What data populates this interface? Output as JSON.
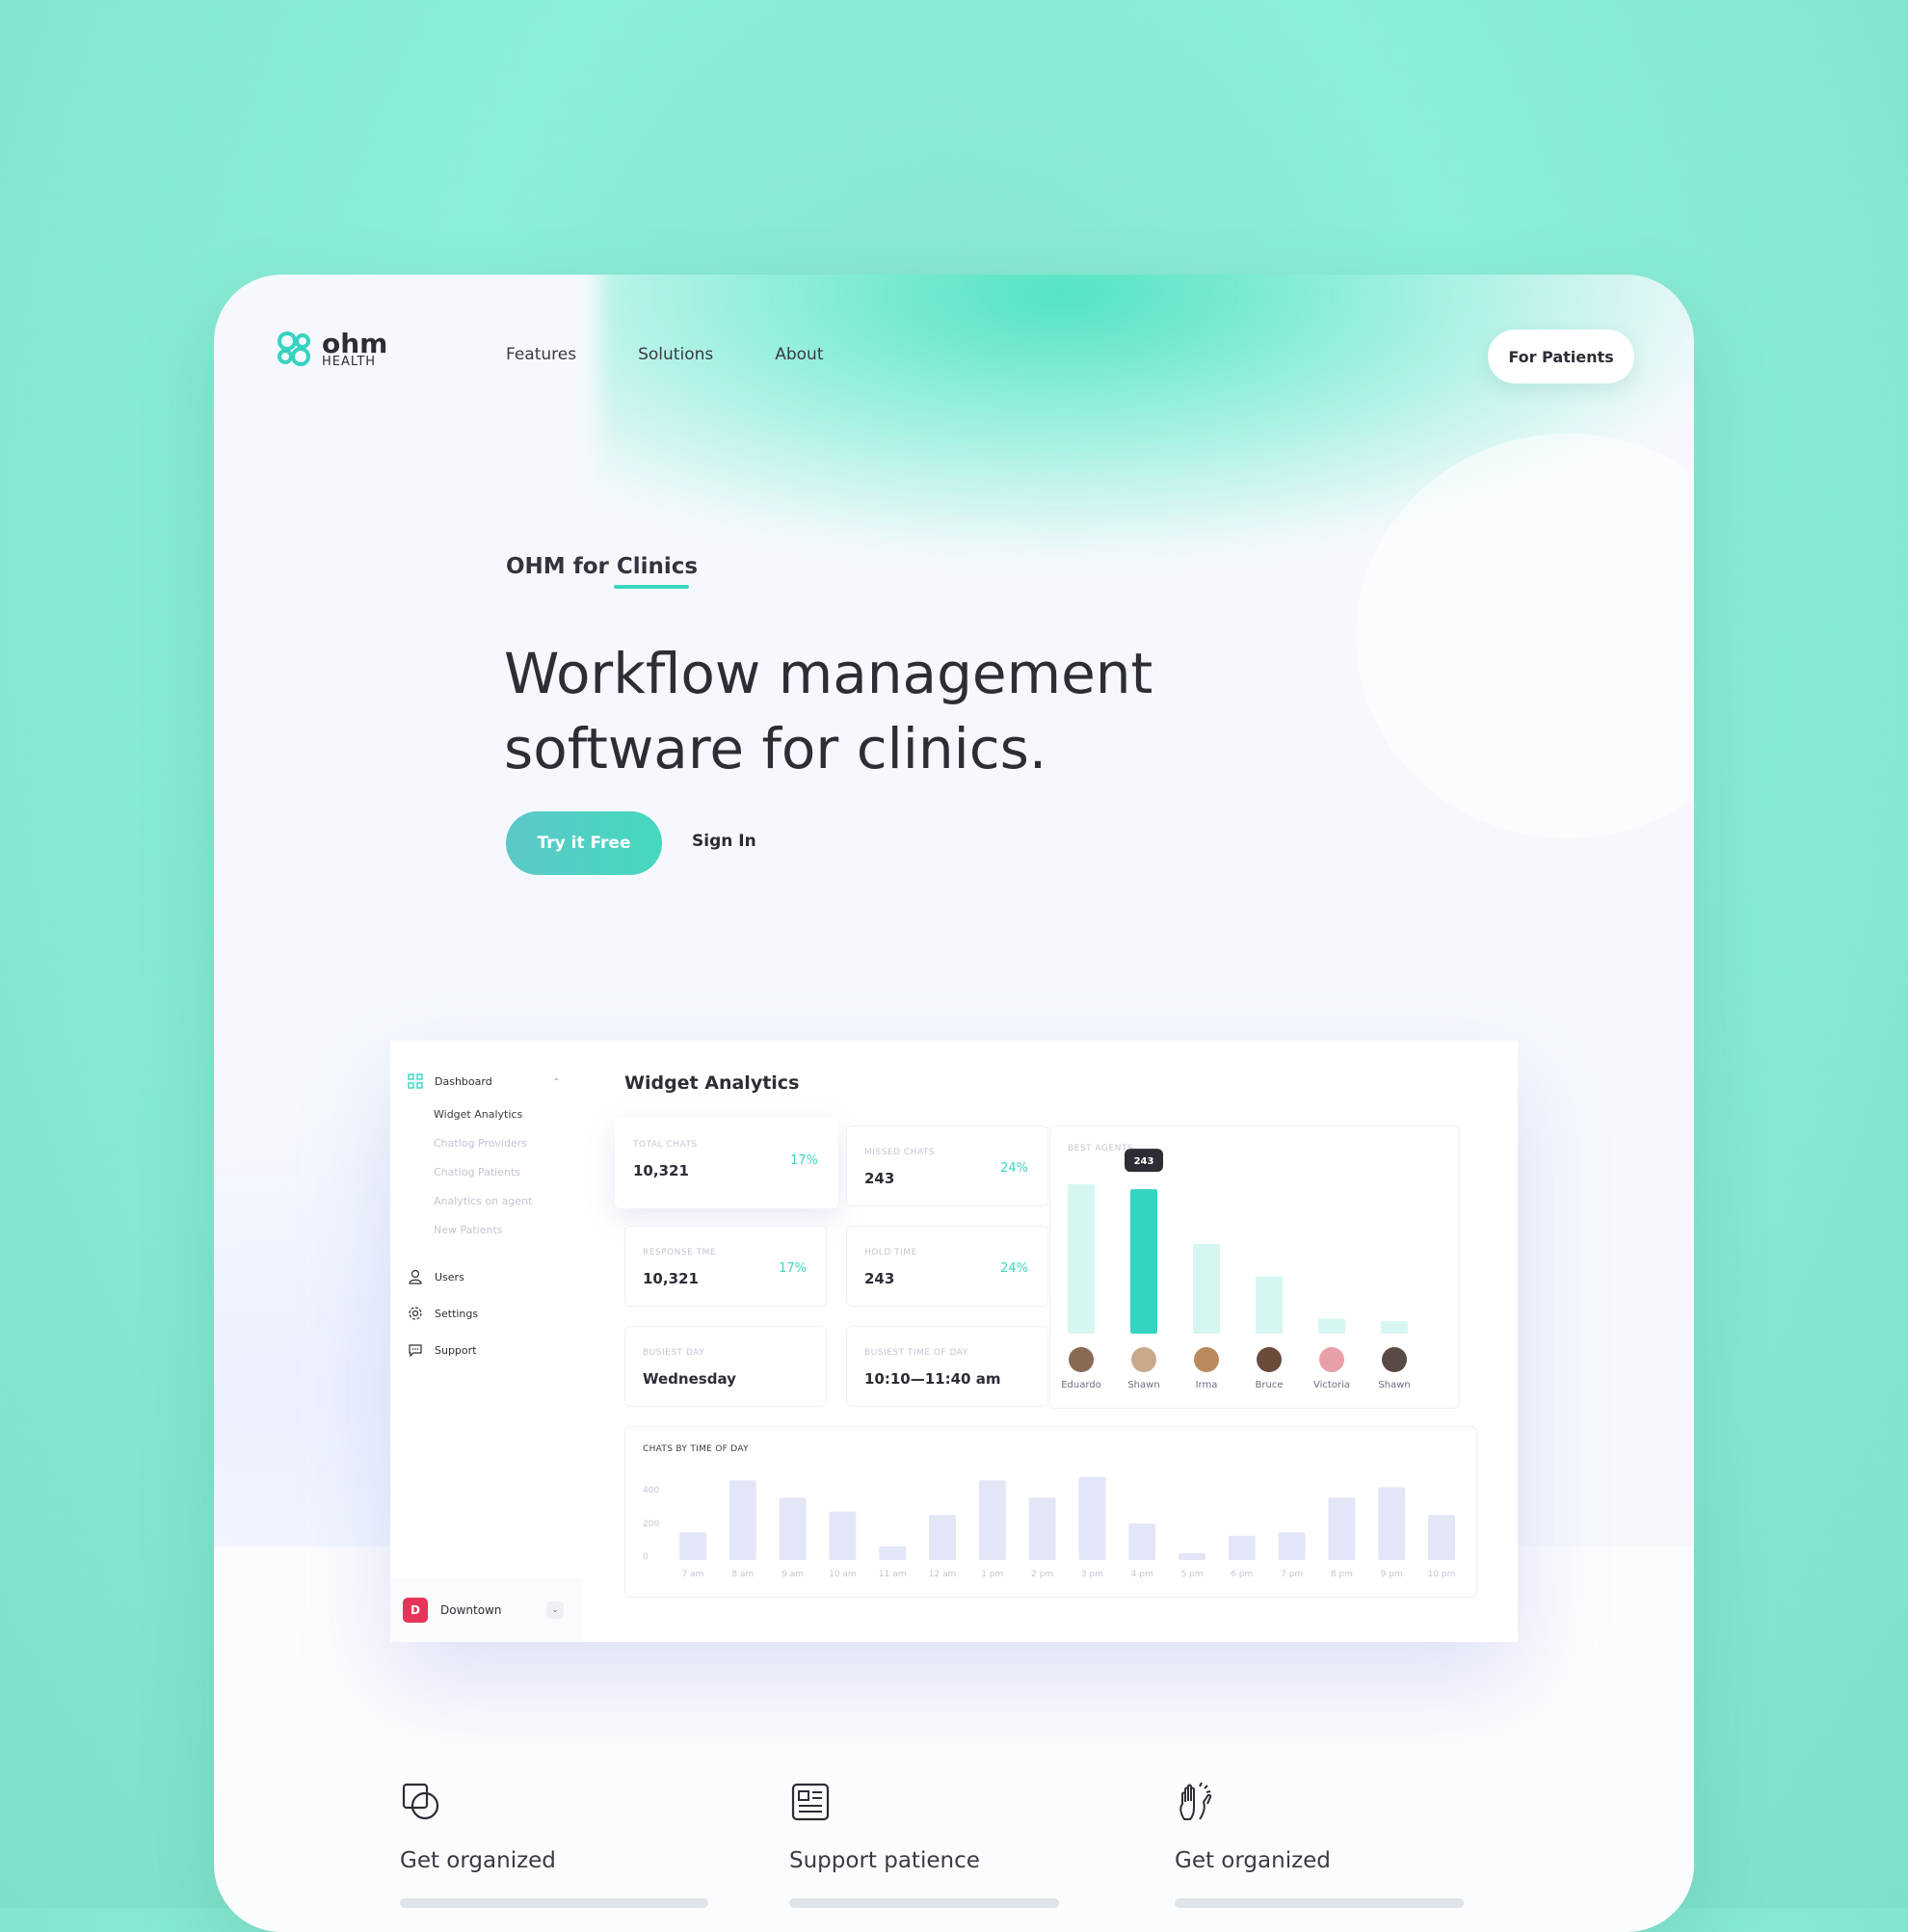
{
  "brand": {
    "name": "ohm",
    "sub": "HEALTH"
  },
  "nav": {
    "items": [
      "Features",
      "Solutions",
      "About"
    ],
    "cta": "For Patients"
  },
  "hero": {
    "eyebrow": "OHM for Clinics",
    "headline_line1": "Workflow management",
    "headline_line2": "software for clinics.",
    "primary_cta": "Try it Free",
    "secondary_cta": "Sign In"
  },
  "dashboard": {
    "title": "Widget Analytics",
    "sidebar": {
      "dashboard_label": "Dashboard",
      "subitems": [
        "Widget Analytics",
        "Chatlog Providers",
        "Chatlog Patients",
        "Analytics on agent",
        "New Patients"
      ],
      "items": [
        "Users",
        "Settings",
        "Support"
      ]
    },
    "location": {
      "initial": "D",
      "label": "Downtown"
    },
    "stats": [
      {
        "label": "TOTAL CHATS",
        "value": "10,321",
        "pct": "17%"
      },
      {
        "label": "MISSED CHATS",
        "value": "243",
        "pct": "24%"
      },
      {
        "label": "RESPONSE TME",
        "value": "10,321",
        "pct": "17%"
      },
      {
        "label": "HOLD TIME",
        "value": "243",
        "pct": "24%"
      },
      {
        "label": "BUSIEST DAY",
        "value": "Wednesday"
      },
      {
        "label": "BUSIEST TIME OF DAY",
        "value": "10:10—11:40 am"
      }
    ],
    "best_agents_label": "BEST AGENTS",
    "chats_label": "CHATS BY TIME OF DAY"
  },
  "chart_data": [
    {
      "type": "bar",
      "title": "BEST AGENTS",
      "categories": [
        "Eduardo",
        "Shawn",
        "Irma",
        "Bruce",
        "Victoria",
        "Shawn"
      ],
      "values": [
        300,
        290,
        180,
        115,
        30,
        25
      ],
      "highlight_index": 1,
      "tooltip": "243",
      "colors": {
        "bar": "#d5f6f1",
        "highlight": "#35d3c2",
        "tooltip": "#2d2d36"
      }
    },
    {
      "type": "bar",
      "title": "CHATS BY TIME OF DAY",
      "categories": [
        "7 am",
        "8 am",
        "9 am",
        "10 am",
        "11 am",
        "12 am",
        "1 pm",
        "2 pm",
        "3 pm",
        "4 pm",
        "5 pm",
        "6 pm",
        "7 pm",
        "8 pm",
        "9 pm",
        "10 pm"
      ],
      "values": [
        160,
        460,
        360,
        280,
        80,
        260,
        460,
        360,
        480,
        210,
        40,
        140,
        160,
        360,
        420,
        260
      ],
      "yticks": [
        "400",
        "200",
        "0"
      ],
      "ylim": [
        0,
        500
      ],
      "colors": {
        "bar": "#e3e6f7"
      }
    }
  ],
  "features": [
    {
      "title": "Get organized",
      "icon": "overlapping-squares-icon"
    },
    {
      "title": "Support patience",
      "icon": "newspaper-icon"
    },
    {
      "title": "Get organized",
      "icon": "high-five-icon"
    }
  ],
  "colors": {
    "accent": "#3ad6bf",
    "background": "#8cefd8",
    "text": "#2d2d36",
    "location_badge": "#e8345a"
  }
}
